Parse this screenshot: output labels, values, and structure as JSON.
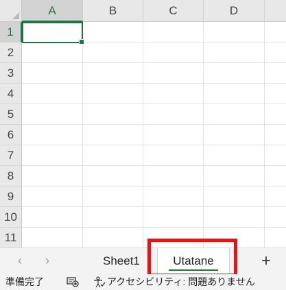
{
  "spreadsheet": {
    "columns": [
      "A",
      "B",
      "C",
      "D"
    ],
    "rows": [
      "1",
      "2",
      "3",
      "4",
      "5",
      "6",
      "7",
      "8",
      "9",
      "10",
      "11"
    ],
    "active_cell": "A1"
  },
  "sheet_tabs": {
    "prev_arrow": "‹",
    "next_arrow": "›",
    "tabs": [
      {
        "label": "Sheet1",
        "active": false
      },
      {
        "label": "Utatane",
        "active": true
      }
    ],
    "add_sheet_label": "+"
  },
  "status_bar": {
    "ready": "準備完了",
    "accessibility": "アクセシビリティ: 問題ありません"
  },
  "colors": {
    "excel_green": "#217346",
    "highlight_red": "#ee1111"
  }
}
